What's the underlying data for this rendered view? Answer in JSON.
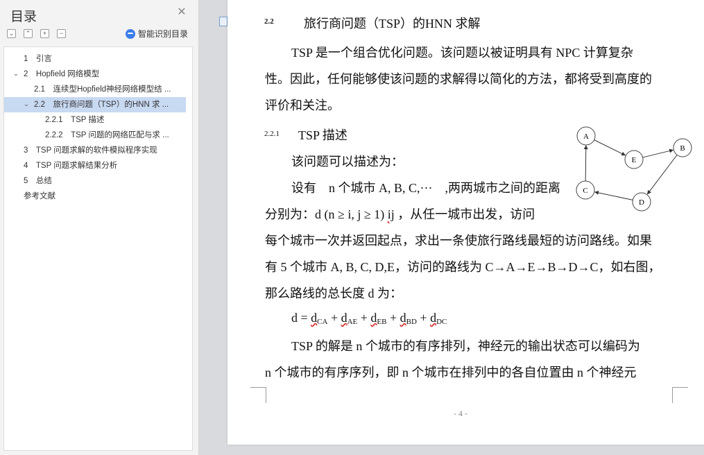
{
  "sidebar": {
    "title": "目录",
    "smart_toc_label": "智能识别目录",
    "toc": [
      {
        "label": "1　引言",
        "level": 1,
        "chevron": ""
      },
      {
        "label": "2　Hopfield 网络模型",
        "level": 1,
        "chevron": "⌄"
      },
      {
        "label": "2.1　连续型Hopfield神经网络模型结 ...",
        "level": 2,
        "chevron": ""
      },
      {
        "label": "2.2　旅行商问题（TSP）的HNN 求 ...",
        "level": 2,
        "chevron": "⌄",
        "selected": true
      },
      {
        "label": "2.2.1　TSP 描述",
        "level": 3,
        "chevron": ""
      },
      {
        "label": "2.2.2　TSP 问题的网络匹配与求 ...",
        "level": 3,
        "chevron": ""
      },
      {
        "label": "3　TSP 问题求解的软件模拟程序实现",
        "level": 1,
        "chevron": ""
      },
      {
        "label": "4　TSP 问题求解结果分析",
        "level": 1,
        "chevron": ""
      },
      {
        "label": "5　总结",
        "level": 1,
        "chevron": ""
      },
      {
        "label": "参考文献",
        "level": 1,
        "chevron": ""
      }
    ]
  },
  "doc": {
    "sec_num": "2.2",
    "sec_title": "旅行商问题（TSP）的HNN 求解",
    "p1_l1": "TSP 是一个组合优化问题。该问题以被证明具有 NPC 计算复杂",
    "p1_l2": "性。因此，任何能够使该问题的求解得以简化的方法，都将受到高度的",
    "p1_l3": "评价和关注。",
    "sub_num": "2.2.1",
    "sub_title": "TSP 描述",
    "p2": "该问题可以描述为：",
    "p3_l1": "设有　n 个城市 A, B, C,···　,两两城市之间的距离",
    "p3_l2a": "分别为：d (n ≥ i, j ≥ 1) ",
    "p3_l2b": "ij",
    "p3_l2c": " ，从任一城市出发，访问",
    "p3_l3": "每个城市一次并返回起点，求出一条使旅行路线最短的访问路线。如果",
    "p3_l4": "有 5 个城市 A, B, C, D,E，访问的路线为 C→A→E→B→D→C，如右图，",
    "p3_l5": "那么路线的总长度 d 为：",
    "formula": {
      "lhs": "d = ",
      "terms": [
        {
          "d": "d",
          "s": "CA"
        },
        {
          "d": "d",
          "s": "AE"
        },
        {
          "d": "d",
          "s": "EB"
        },
        {
          "d": "d",
          "s": "BD"
        },
        {
          "d": "d",
          "s": "DC"
        }
      ],
      "plus": " + "
    },
    "p4_l1": "TSP 的解是 n 个城市的有序排列，神经元的输出状态可以编码为",
    "p4_l2": "n 个城市的有序序列，即 n 个城市在排列中的各自位置由 n 个神经元",
    "page_num": "- 4 -"
  },
  "diagram": {
    "nodes": [
      "A",
      "E",
      "B",
      "D",
      "C"
    ],
    "route": [
      "C",
      "A",
      "E",
      "B",
      "D",
      "C"
    ]
  }
}
